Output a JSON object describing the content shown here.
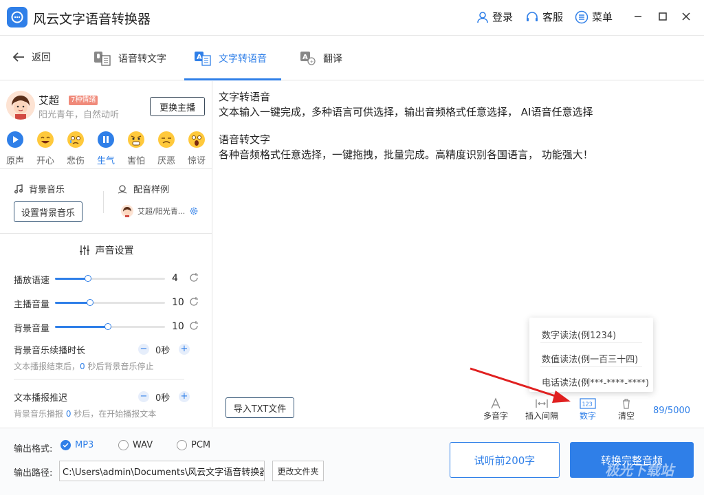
{
  "app": {
    "title": "风云文字语音转换器"
  },
  "titlebar": {
    "login": "登录",
    "service": "客服",
    "menu": "菜单"
  },
  "nav": {
    "back": "返回",
    "tabs": [
      {
        "label": "语音转文字"
      },
      {
        "label": "文字转语音"
      },
      {
        "label": "翻译"
      }
    ]
  },
  "speaker": {
    "name": "艾超",
    "badge": "7种情绪",
    "desc": "阳光青年，自然动听",
    "change": "更换主播"
  },
  "emotions": [
    {
      "label": "原声"
    },
    {
      "label": "开心"
    },
    {
      "label": "悲伤"
    },
    {
      "label": "生气"
    },
    {
      "label": "害怕"
    },
    {
      "label": "厌恶"
    },
    {
      "label": "惊讶"
    }
  ],
  "bgm": {
    "label": "背景音乐",
    "button": "设置背景音乐"
  },
  "sample": {
    "label": "配音样例",
    "item": "艾超/阳光青..."
  },
  "voice": {
    "title": "声音设置",
    "sliders": [
      {
        "name": "播放语速",
        "value": "4",
        "fraction": 0.3
      },
      {
        "name": "主播音量",
        "value": "10",
        "fraction": 0.32
      },
      {
        "name": "背景音量",
        "value": "10",
        "fraction": 0.48
      }
    ],
    "bgm_duration": {
      "name": "背景音乐续播时长",
      "value": "0秒",
      "hint_pre": "文本播报结束后，",
      "hint_num": "0",
      "hint_post": " 秒后背景音乐停止"
    },
    "delay": {
      "name": "文本播报推迟",
      "value": "0秒",
      "hint_pre": "背景音乐播报 ",
      "hint_num": "0",
      "hint_post": " 秒后，在开始播报文本"
    }
  },
  "editor": {
    "lines": [
      "文字转语音",
      "文本输入一键完成，多种语言可供选择，输出音频格式任意选择， AI语音任意选择",
      "语音转文字",
      "各种音频格式任意选择，一键拖拽，批量完成。高精度识别各国语言， 功能强大！"
    ]
  },
  "dropdown": {
    "items": [
      {
        "label": "数字读法(例1234)"
      },
      {
        "label": "数值读法(例一百三十四)"
      },
      {
        "label": "电话读法(例***-****-****)"
      }
    ]
  },
  "toolbar": {
    "import": "导入TXT文件",
    "tools": [
      {
        "label": "多音字"
      },
      {
        "label": "插入间隔"
      },
      {
        "label": "数字",
        "icon_text": "123"
      },
      {
        "label": "清空"
      }
    ],
    "count": "89/5000"
  },
  "output": {
    "format_label": "输出格式:",
    "formats": [
      {
        "label": "MP3",
        "selected": true
      },
      {
        "label": "WAV"
      },
      {
        "label": "PCM"
      }
    ],
    "path_label": "输出路径:",
    "path": "C:\\Users\\admin\\Documents\\风云文字语音转换器",
    "change_dir": "更改文件夹",
    "preview": "试听前200字",
    "convert": "转换完整音频"
  },
  "watermark": "极光下载站",
  "colors": {
    "accent": "#2f7fe8",
    "arrow": "#e02020",
    "badge": "#f08a7a"
  }
}
